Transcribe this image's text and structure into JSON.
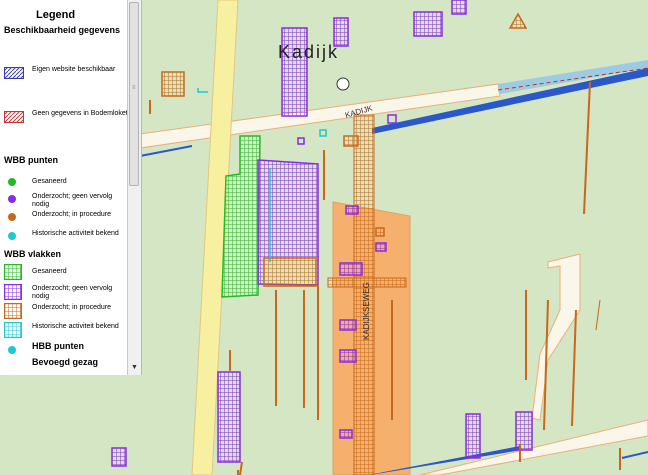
{
  "legend": {
    "title": "Legend",
    "group_availability": "Beschikbaarheid gegevens",
    "own_website": "Eigen website beschikbaar",
    "no_data": "Geen gegevens in Bodemloket",
    "wbb_points_header": "WBB punten",
    "wbb_points": [
      "Gesaneerd",
      "Onderzocht; geen vervolg nodig",
      "Onderzocht; in procedure",
      "Historische activiteit bekend"
    ],
    "wbb_areas_header": "WBB vlakken",
    "wbb_areas": [
      "Gesaneerd",
      "Onderzocht; geen vervolg nodig",
      "Onderzocht; in procedure",
      "Historische activiteit bekend"
    ],
    "hbb_points_header": "HBB punten",
    "authority_header": "Bevoegd gezag"
  },
  "map": {
    "town_label": "Kadijk",
    "street_kadijk": "KADIJK",
    "street_vertical": "KADIJKSEWEG"
  },
  "colors": {
    "green": "#22bb22",
    "purple": "#8a2be2",
    "orange": "#c8681a",
    "cyan": "#1ec8d0",
    "blue_hatch": "#3a3ab8",
    "red_hatch": "#cc3333",
    "road_yellow": "#f5ee9a",
    "road_white": "#fbf6ea",
    "parcel_orange": "#f4b06c"
  },
  "icons": [
    "scroll-down-arrow-icon",
    "town-marker-icon"
  ]
}
